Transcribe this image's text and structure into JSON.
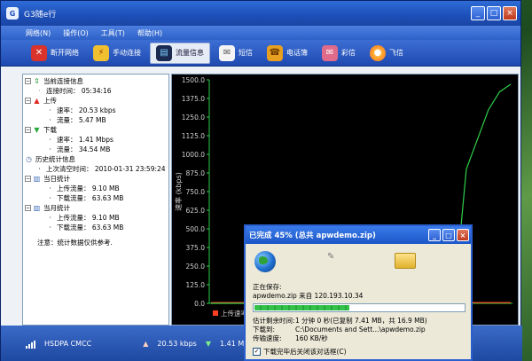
{
  "window": {
    "title": "G3随e行",
    "controls": [
      "_",
      "□",
      "×"
    ]
  },
  "menu": [
    "网络(N)",
    "操作(O)",
    "工具(T)",
    "帮助(H)"
  ],
  "toolbar": {
    "disconnect": "断开网络",
    "manual_connect": "手动连接",
    "traffic_info": "流量信息",
    "sms": "短信",
    "phonebook": "电话簿",
    "mms": "彩信",
    "fetion": "飞信"
  },
  "tree": {
    "current": "当前连接信息",
    "conn_time": "连接时间：  05:34:16",
    "upload": "上传",
    "up_rate": "速率：  20.53 kbps",
    "up_flow": "流量：  5.47 MB",
    "download": "下载",
    "down_rate": "速率：  1.41 Mbps",
    "down_flow": "流量：  34.54 MB",
    "history": "历史统计信息",
    "last_clear": "上次清空时间：  2010-01-31 23:59:24",
    "day": "当日统计",
    "day_up": "上传流量：  9.10 MB",
    "day_down": "下载流量：  63.63 MB",
    "month": "当月统计",
    "month_up": "上传流量：  9.10 MB",
    "month_down": "下载流量：  63.63 MB",
    "note": "注意：统计数据仅供参考."
  },
  "chart_data": {
    "type": "line",
    "ylabel": "速率 (kbps)",
    "yticks": [
      "1500.0",
      "1375.0",
      "1250.0",
      "1125.0",
      "1000.0",
      "875.0",
      "750.0",
      "625.0",
      "500.0",
      "375.0",
      "250.0",
      "125.0",
      "0.0"
    ],
    "ylim": [
      0,
      1500
    ],
    "legend": "上传速率",
    "series": [
      {
        "name": "上传速率",
        "color": "#ff4020",
        "values": [
          5,
          5,
          5,
          5,
          5,
          5,
          5,
          5,
          5,
          5,
          5,
          5,
          5,
          5,
          5,
          5,
          5,
          5,
          5,
          5,
          5,
          5,
          5,
          5,
          5,
          5,
          5,
          5
        ]
      },
      {
        "name": "",
        "color": "#2fd04a",
        "values": [
          0,
          0,
          0,
          0,
          0,
          0,
          0,
          0,
          0,
          0,
          0,
          0,
          0,
          0,
          0,
          0,
          0,
          0,
          0,
          0,
          0,
          120,
          100,
          900,
          1100,
          1300,
          1420,
          1470
        ]
      }
    ]
  },
  "status": {
    "network": "HSDPA  CMCC",
    "up": "20.53 kbps",
    "down": "1.41 Mbp"
  },
  "dialog": {
    "title": "已完成 45% (总共 apwdemo.zip)",
    "saving": "正在保存:",
    "file_from": "apwdemo.zip 来自 120.193.10.34",
    "progress": 0.45,
    "remain_k": "估计剩余时间:",
    "remain_v": "1 分钟 0 秒(已复制 7.41 MB，共 16.9 MB)",
    "to_k": "下载到:",
    "to_v": "C:\\Documents and Sett...\\apwdemo.zip",
    "speed_k": "传输速度:",
    "speed_v": "160 KB/秒",
    "close_after": "下载完毕后关闭该对话框(C)"
  }
}
